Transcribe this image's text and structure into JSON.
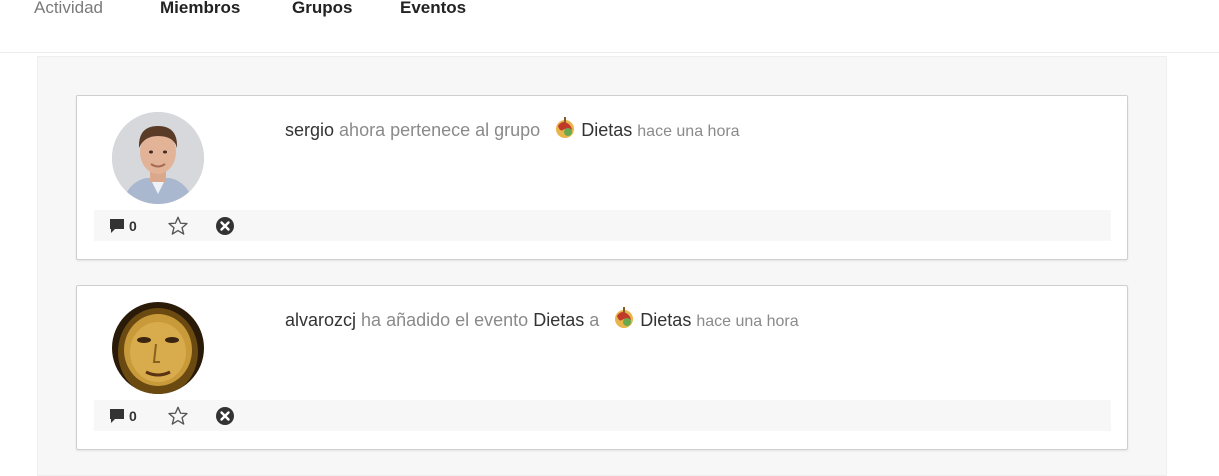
{
  "nav": {
    "tabs": [
      {
        "label": "Actividad",
        "active": true
      },
      {
        "label": "Miembros",
        "active": false
      },
      {
        "label": "Grupos",
        "active": false
      },
      {
        "label": "Eventos",
        "active": false
      }
    ]
  },
  "activities": [
    {
      "avatar": "man-in-suit-photo",
      "user": "sergio",
      "action_text": "ahora pertenece al grupo",
      "group_icon": "food-group-icon",
      "group_name": "Dietas",
      "time": "hace una hora",
      "comment_count": "0"
    },
    {
      "avatar": "mona-lisa-photo",
      "user": "alvarozcj",
      "action_text": "ha añadido el evento",
      "event_name": "Dietas",
      "connector": "a",
      "group_icon": "food-group-icon",
      "group_name": "Dietas",
      "time": "hace una hora",
      "comment_count": "0"
    }
  ],
  "icons": {
    "comment": "comment-icon",
    "star": "star-icon",
    "remove": "close-circle-icon"
  }
}
